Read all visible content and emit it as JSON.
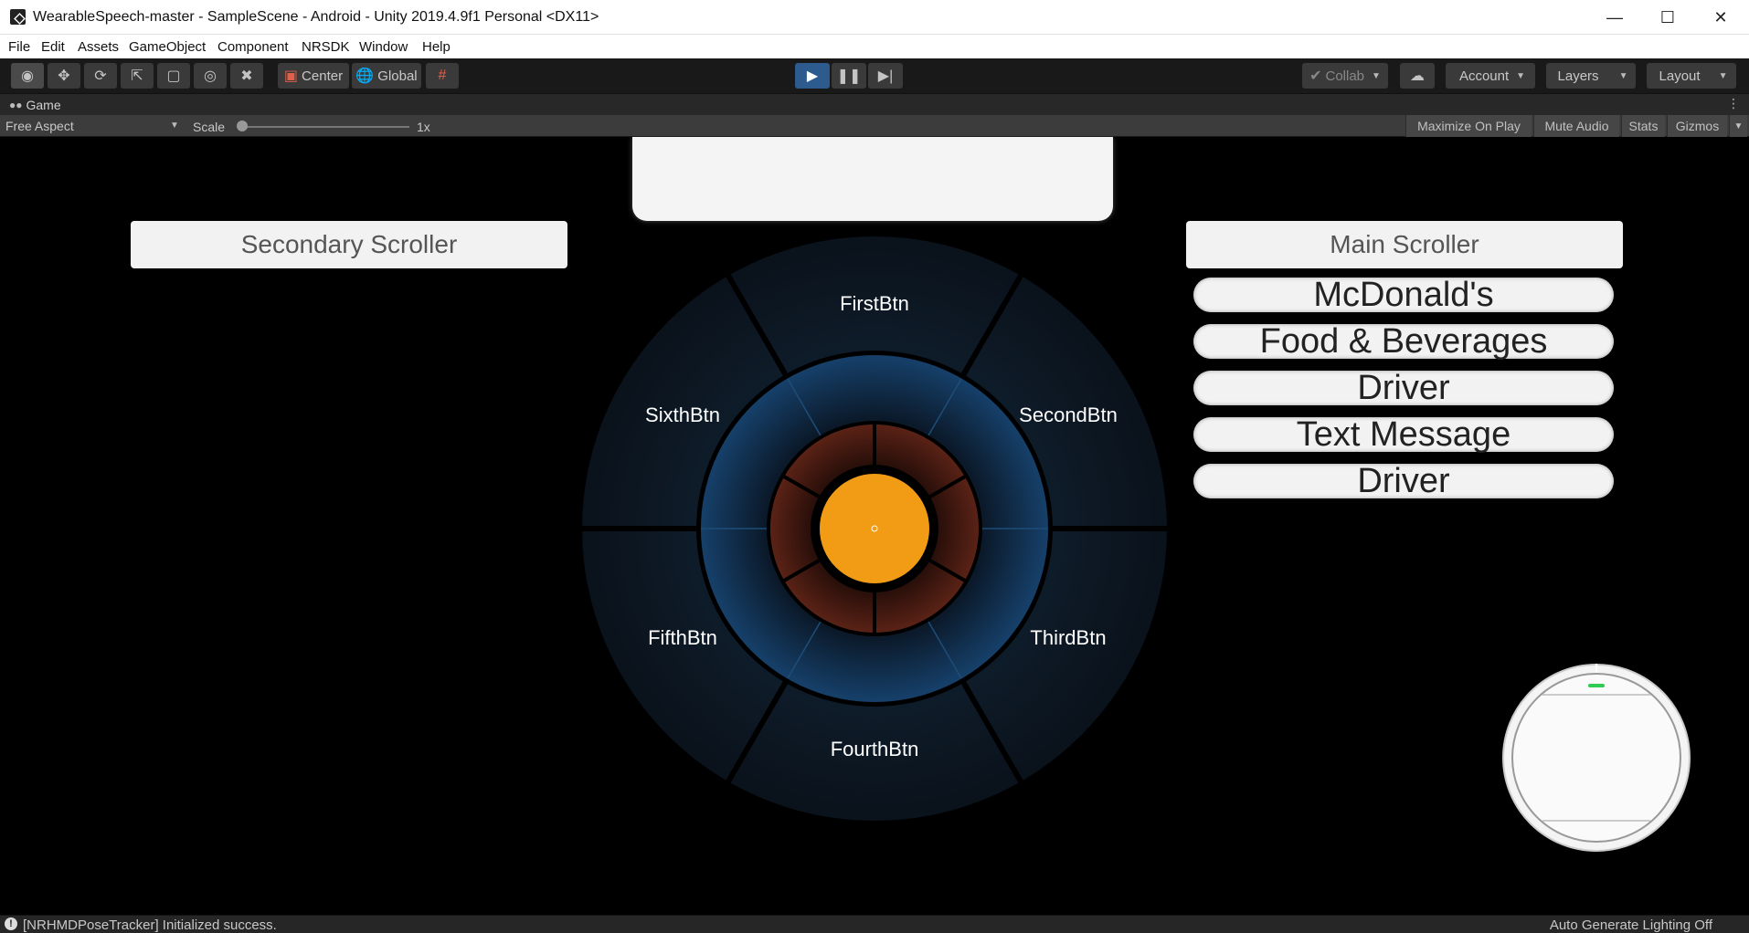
{
  "window": {
    "title": "WearableSpeech-master - SampleScene - Android - Unity 2019.4.9f1 Personal <DX11>",
    "controls": [
      "minimize-icon",
      "maximize-icon",
      "close-icon"
    ]
  },
  "menu": [
    "File",
    "Edit",
    "Assets",
    "GameObject",
    "Component",
    "NRSDK",
    "Window",
    "Help"
  ],
  "toolbar": {
    "tools": [
      "eye-icon",
      "move-icon",
      "rotate-icon",
      "scale-icon",
      "rect-icon",
      "transform-icon",
      "custom-tool-icon"
    ],
    "pivot_label": "Center",
    "space_label": "Global",
    "grid_snap": "grid-snap-icon",
    "play": {
      "playing": true
    },
    "collab_label": "Collab",
    "account_label": "Account",
    "layers_label": "Layers",
    "layout_label": "Layout"
  },
  "tab": {
    "label": "Game",
    "icon": "gamepad-icon"
  },
  "gamebar": {
    "aspect": "Free Aspect",
    "scale_label": "Scale",
    "scale_value": "1x",
    "buttons": [
      "Maximize On Play",
      "Mute Audio",
      "Stats",
      "Gizmos"
    ]
  },
  "scene": {
    "secondary_scroller": "Secondary Scroller",
    "main_scroller": "Main Scroller",
    "main_items": [
      "McDonald's",
      "Food & Beverages",
      "Driver",
      "Text Message",
      "Driver"
    ],
    "wheel_buttons": [
      "FirstBtn",
      "SecondBtn",
      "ThirdBtn",
      "FourthBtn",
      "FifthBtn",
      "SixthBtn"
    ],
    "colors": {
      "outer_ring": "#0d1520",
      "middle_ring": "#0f2e4a",
      "inner_ring": "#4a1a12",
      "core": "#f19c14",
      "panel": "#f2f2f2"
    }
  },
  "status": {
    "message": "[NRHMDPoseTracker] Initialized success.",
    "right": "Auto Generate Lighting Off"
  }
}
